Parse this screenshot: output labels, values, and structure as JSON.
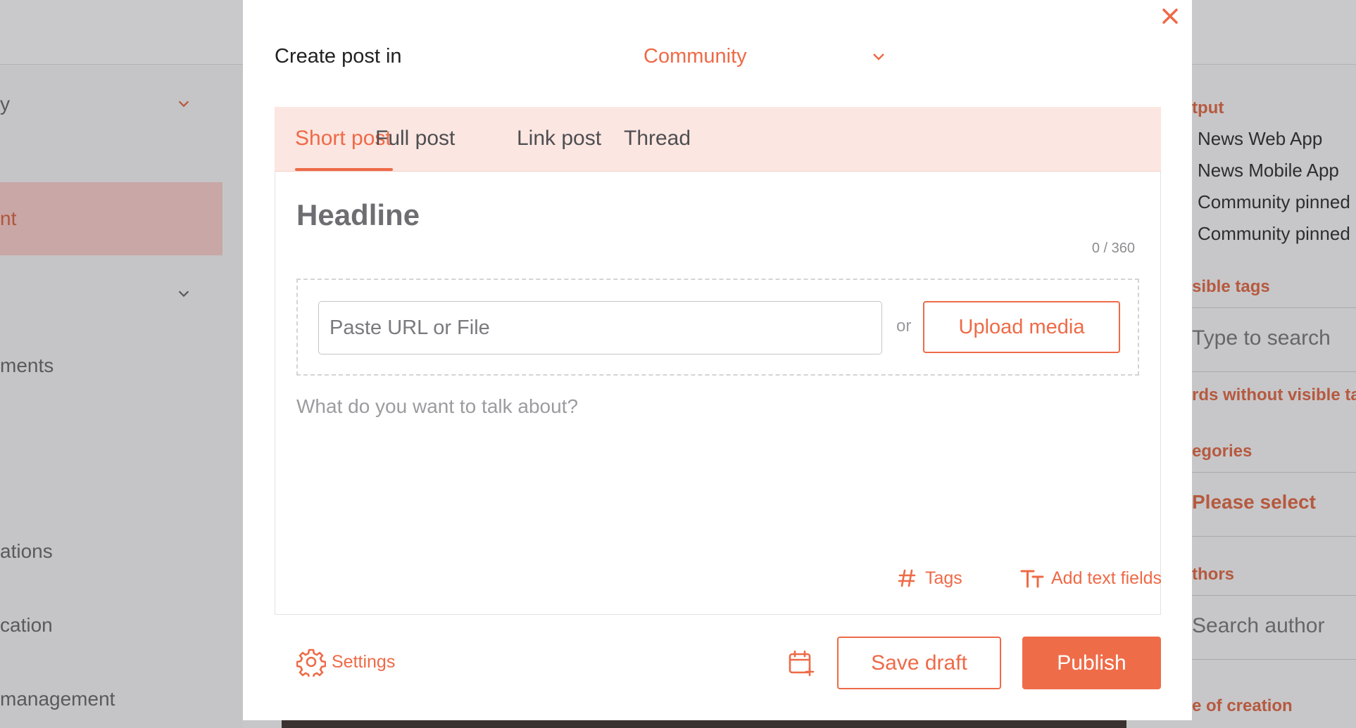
{
  "background": {
    "left_nav": [
      {
        "label": "y",
        "has_chevron": true
      },
      {
        "label": "nt",
        "active": true
      },
      {
        "label": "",
        "has_chevron": true
      },
      {
        "label": "ments"
      },
      {
        "label": "ations"
      },
      {
        "label": "cation"
      },
      {
        "label": "management"
      }
    ],
    "right_panel": {
      "output_label": "tput",
      "output_options": [
        "News Web App",
        "News Mobile App",
        "Community pinned",
        "Community pinned"
      ],
      "visible_tags_label": "sible tags",
      "tags_search_placeholder": "Type to search",
      "no_visible_tags_label": "rds without visible ta",
      "categories_label": "egories",
      "categories_value": "Please select",
      "authors_label": "thors",
      "author_search_placeholder": "Search author",
      "creation_label": "e of creation"
    }
  },
  "modal": {
    "create_post_label": "Create post in",
    "community_value": "Community",
    "tabs": [
      {
        "label": "Short post",
        "active": true
      },
      {
        "label": "Full post",
        "active": false
      },
      {
        "label": "Link post",
        "active": false
      },
      {
        "label": "Thread",
        "active": false
      }
    ],
    "headline_placeholder": "Headline",
    "char_counter": "0 / 360",
    "media": {
      "url_placeholder": "Paste URL or File",
      "or_text": "or",
      "upload_label": "Upload media"
    },
    "body_placeholder": "What do you want to talk about?",
    "tags_label": "Tags",
    "add_text_fields_label": "Add text fields",
    "settings_label": "Settings",
    "save_draft_label": "Save draft",
    "publish_label": "Publish"
  },
  "colors": {
    "accent": "#ee6a47",
    "tab_bar_bg": "#fce6e1",
    "overlay_bg": "#c7c7c9"
  },
  "icons": [
    "close-icon",
    "chevron-down-icon",
    "hash-icon",
    "text-size-icon",
    "gear-icon",
    "calendar-add-icon"
  ]
}
